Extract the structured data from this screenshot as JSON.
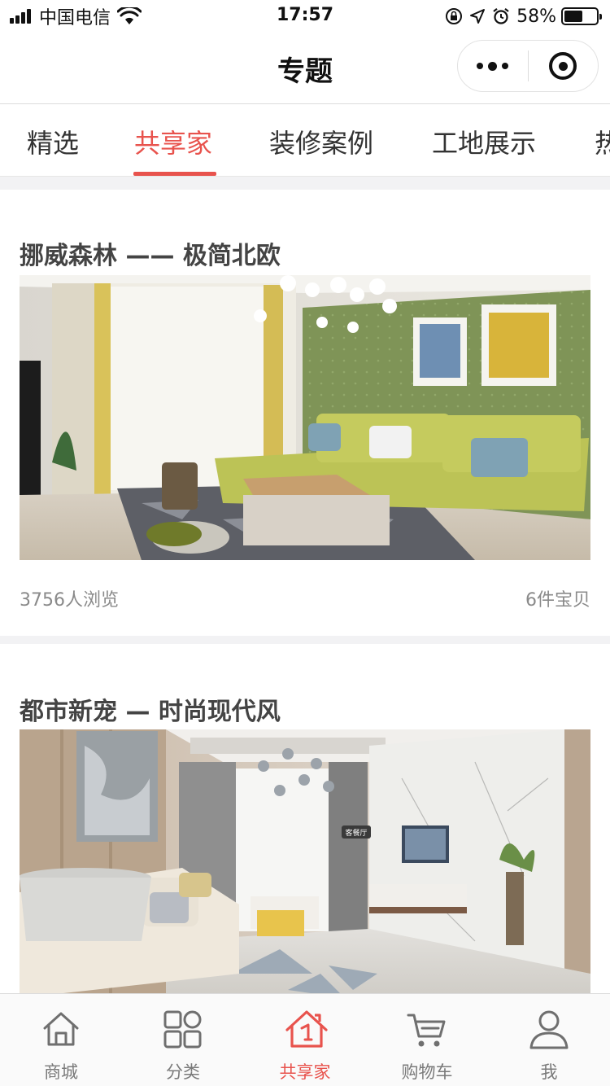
{
  "status_bar": {
    "carrier": "中国电信",
    "time": "17:57",
    "battery": "58%",
    "battery_level": 0.58
  },
  "nav": {
    "title": "专题",
    "more_icon": "more-dots-icon",
    "close_icon": "target-circle-icon"
  },
  "tabs": [
    {
      "label": "精选",
      "active": false
    },
    {
      "label": "共享家",
      "active": true
    },
    {
      "label": "装修案例",
      "active": false
    },
    {
      "label": "工地展示",
      "active": false
    },
    {
      "label": "热",
      "active": false
    }
  ],
  "cards": [
    {
      "title": "挪威森林 —— 极简北欧",
      "views": "3756人浏览",
      "items": "6件宝贝"
    },
    {
      "title": "都市新宠 — 时尚现代风",
      "image_label": "客餐厅"
    }
  ],
  "bottom_nav": [
    {
      "label": "商城",
      "icon": "home-icon",
      "active": false
    },
    {
      "label": "分类",
      "icon": "category-grid-icon",
      "active": false
    },
    {
      "label": "共享家",
      "icon": "shared-home-icon",
      "active": true
    },
    {
      "label": "购物车",
      "icon": "cart-icon",
      "active": false
    },
    {
      "label": "我",
      "icon": "user-icon",
      "active": false
    }
  ],
  "colors": {
    "accent": "#e8534d",
    "text_primary": "#333333",
    "text_secondary": "#8a8a8a",
    "background": "#f2f2f4"
  }
}
